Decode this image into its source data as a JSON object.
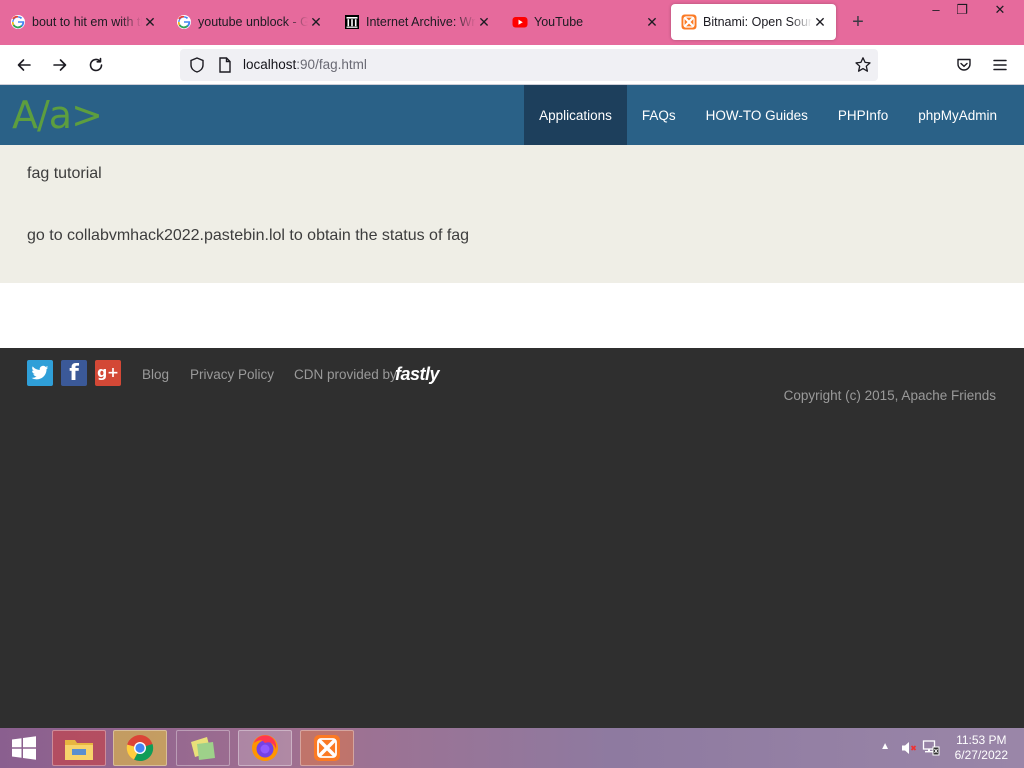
{
  "browser": {
    "tabs": [
      {
        "title": "bout to hit em with th",
        "icon": "google-icon",
        "active": false
      },
      {
        "title": "youtube unblock - Go",
        "icon": "google-icon",
        "active": false
      },
      {
        "title": "Internet Archive: Wri",
        "icon": "internet-archive-icon",
        "active": false
      },
      {
        "title": "YouTube",
        "icon": "youtube-icon",
        "active": false
      },
      {
        "title": "Bitnami: Open Sourc",
        "icon": "xampp-icon",
        "active": true
      }
    ],
    "close_glyph": "✕",
    "new_tab_glyph": "+",
    "window_controls": {
      "minimize": "–",
      "restore": "❐",
      "close": "✕"
    },
    "url": {
      "host": "localhost",
      "rest": ":90/fag.html"
    },
    "tab_strip_color": "#e66a9c"
  },
  "site": {
    "logo": "A/a>",
    "nav": [
      {
        "label": "Applications",
        "active": true
      },
      {
        "label": "FAQs",
        "active": false
      },
      {
        "label": "HOW-TO Guides",
        "active": false
      },
      {
        "label": "PHPInfo",
        "active": false
      },
      {
        "label": "phpMyAdmin",
        "active": false
      }
    ],
    "header_color": "#2a6187",
    "content": {
      "line1": "fag tutorial",
      "line2": "go to collabvmhack2022.pastebin.lol to obtain the status of fag"
    },
    "footer": {
      "social": [
        {
          "name": "twitter-icon",
          "color": "#2f9fd8",
          "glyph": "🐦"
        },
        {
          "name": "facebook-icon",
          "color": "#3b5998",
          "glyph": "f"
        },
        {
          "name": "google-plus-icon",
          "color": "#d34836",
          "glyph": "g+"
        }
      ],
      "blog": "Blog",
      "privacy": "Privacy Policy",
      "cdn": "CDN provided by",
      "fastly": "fastly",
      "copyright": "Copyright (c) 2015, Apache Friends"
    }
  },
  "taskbar": {
    "apps": [
      {
        "name": "file-explorer-icon",
        "running": false
      },
      {
        "name": "chrome-icon",
        "running": false
      },
      {
        "name": "sticky-notes-icon",
        "running": false
      },
      {
        "name": "firefox-icon",
        "running": true
      },
      {
        "name": "xampp-icon",
        "running": false
      }
    ],
    "time": "11:53 PM",
    "date": "6/27/2022"
  }
}
